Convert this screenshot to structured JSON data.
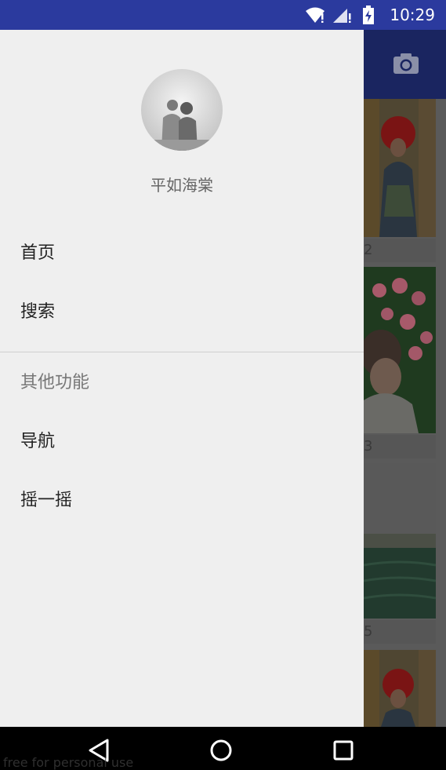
{
  "status_bar": {
    "time": "10:29",
    "icons": [
      "wifi-icon",
      "signal-icon",
      "battery-charging-icon"
    ]
  },
  "background_app": {
    "toolbar_icon": "camera-icon",
    "tiles": [
      {
        "number": "2"
      },
      {
        "number": "3"
      },
      {
        "number": "5"
      },
      {
        "number": ""
      }
    ]
  },
  "drawer": {
    "avatar_icon": "avatar-photo",
    "username": "平如海棠",
    "items": [
      {
        "label": "首页"
      },
      {
        "label": "搜索"
      }
    ],
    "section_title": "其他功能",
    "section_items": [
      {
        "label": "导航"
      },
      {
        "label": "摇一摇"
      }
    ]
  },
  "nav_bar": {
    "icons": [
      "back-icon",
      "home-icon",
      "recents-icon"
    ]
  },
  "watermark": "free for personal use"
}
